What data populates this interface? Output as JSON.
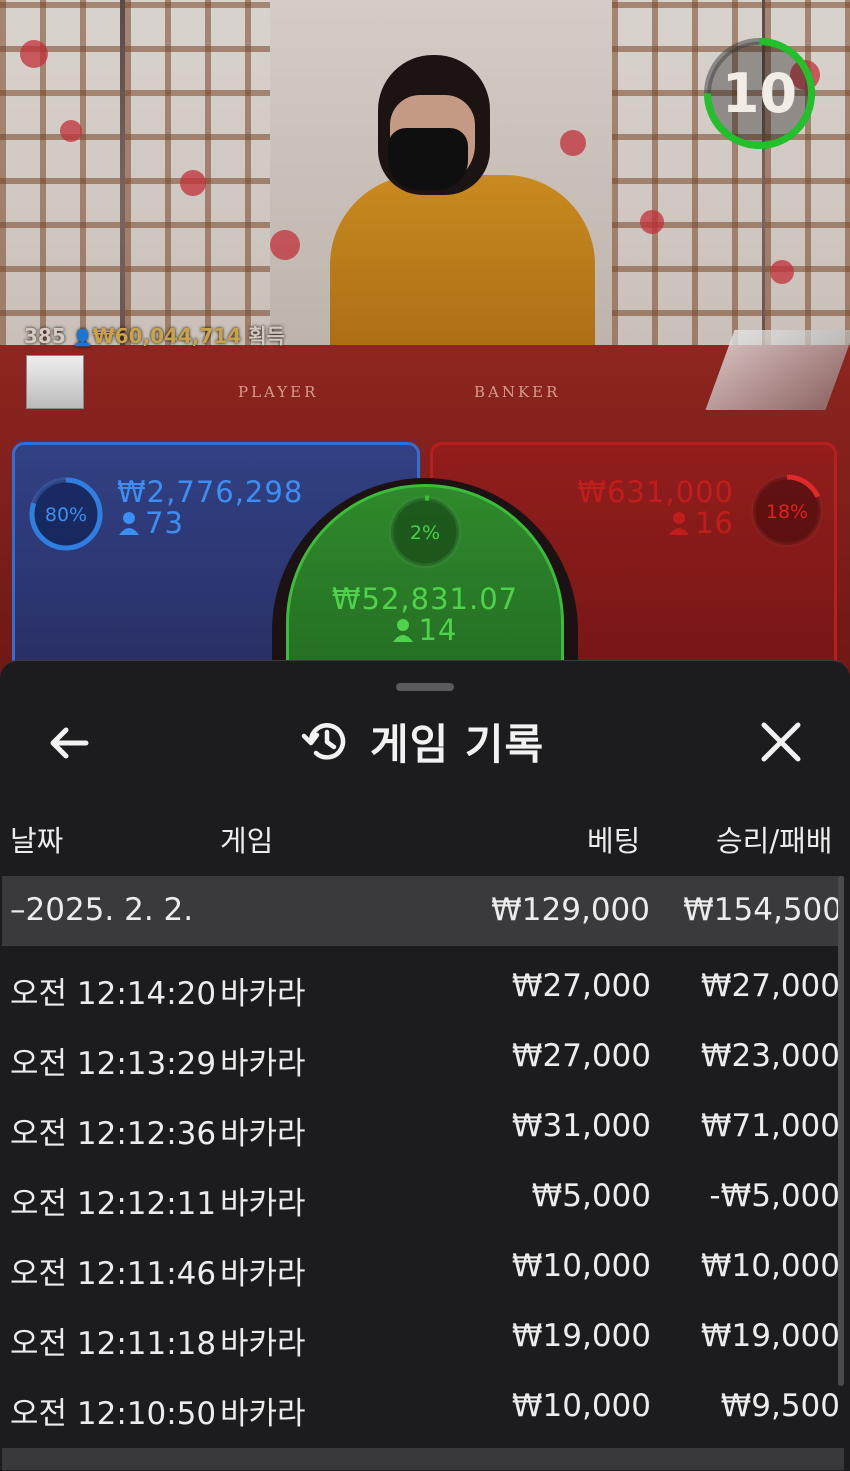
{
  "stream": {
    "timer": "10",
    "viewers": "385",
    "total_won": "₩60,044,714",
    "total_won_label": "획득",
    "table_words": [
      "PLAYER",
      "BANKER"
    ]
  },
  "bets": {
    "player": {
      "percent": "80%",
      "amount": "₩2,776,298",
      "count": "73",
      "fill": 0.8
    },
    "tie": {
      "percent": "2%",
      "amount": "₩52,831.07",
      "count": "14",
      "fill": 0.02
    },
    "banker": {
      "percent": "18%",
      "amount": "₩631,000",
      "count": "16",
      "fill": 0.18
    }
  },
  "sheet": {
    "title": "게임 기록",
    "back_icon": "arrow-left-icon",
    "title_icon": "history-icon",
    "close_icon": "close-icon"
  },
  "columns": {
    "date": "날짜",
    "game": "게임",
    "bet": "베팅",
    "result": "승리/패배"
  },
  "date_group": {
    "date": "–2025. 2. 2.",
    "bet": "₩129,000",
    "result": "₩154,500"
  },
  "rows": [
    {
      "time": "오전 12:14:20",
      "game": "바카라",
      "bet": "₩27,000",
      "result": "₩27,000"
    },
    {
      "time": "오전 12:13:29",
      "game": "바카라",
      "bet": "₩27,000",
      "result": "₩23,000"
    },
    {
      "time": "오전 12:12:36",
      "game": "바카라",
      "bet": "₩31,000",
      "result": "₩71,000"
    },
    {
      "time": "오전 12:12:11",
      "game": "바카라",
      "bet": "₩5,000",
      "result": "-₩5,000"
    },
    {
      "time": "오전 12:11:46",
      "game": "바카라",
      "bet": "₩10,000",
      "result": "₩10,000"
    },
    {
      "time": "오전 12:11:18",
      "game": "바카라",
      "bet": "₩19,000",
      "result": "₩19,000"
    },
    {
      "time": "오전 12:10:50",
      "game": "바카라",
      "bet": "₩10,000",
      "result": "₩9,500"
    }
  ],
  "colors": {
    "player": "#2f7fe0",
    "banker": "#d42a2a",
    "tie": "#3dbb3a",
    "timer": "#22c02a",
    "sheet_bg": "#1c1c1f",
    "date_row_bg": "#3a3a3d"
  }
}
